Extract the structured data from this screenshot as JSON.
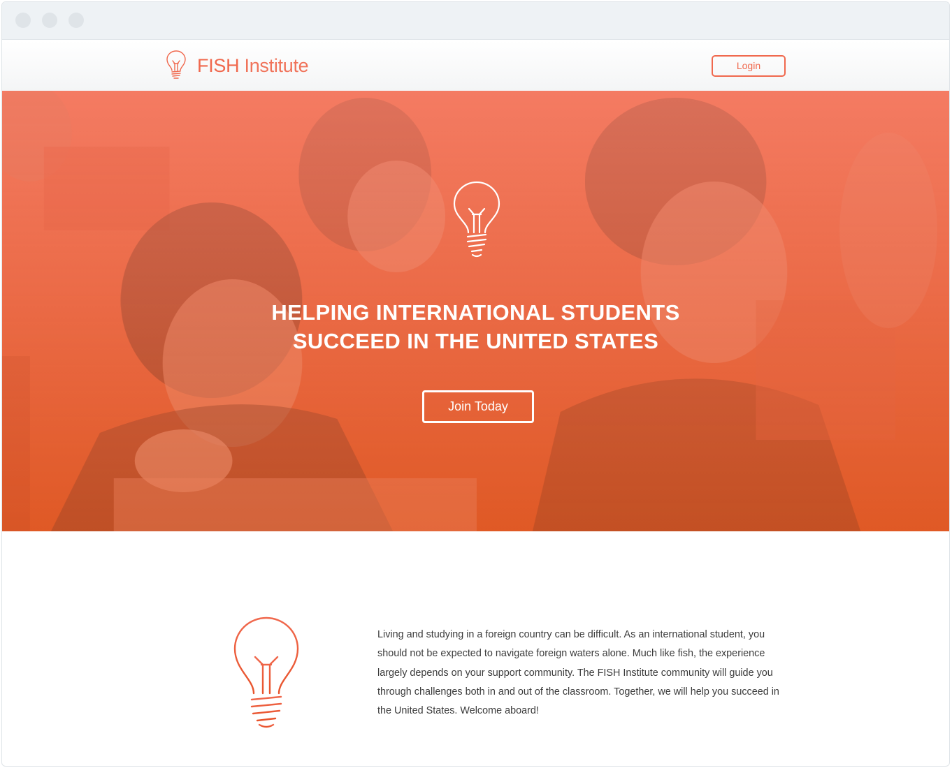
{
  "site": {
    "brand_bold": "FISH",
    "brand_light": "Institute",
    "login_label": "Login"
  },
  "hero": {
    "title_line1": "HELPING INTERNATIONAL STUDENTS",
    "title_line2": "SUCCEED IN THE UNITED STATES",
    "cta_label": "Join Today"
  },
  "about": {
    "text": "Living and studying in a foreign country can be difficult. As an international student, you should not be expected to navigate foreign waters alone. Much like fish, the experience largely depends on your support community. The FISH Institute community will guide you through challenges both in and out of the classroom. Together, we will help you succeed in the United States. Welcome aboard!"
  },
  "icons": {
    "brand": "lightbulb-icon",
    "hero": "lightbulb-icon",
    "about": "lightbulb-icon"
  },
  "colors": {
    "accent": "#f0684d",
    "hero_overlay_top": "#f4785f",
    "hero_overlay_bottom": "#e35d29",
    "text": "#3b3b3b"
  }
}
